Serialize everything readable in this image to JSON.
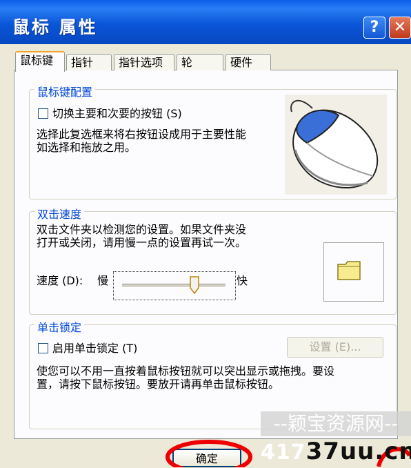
{
  "window": {
    "title": "鼠标 属性",
    "help_label": "?",
    "close_label": "✕"
  },
  "tabs": [
    {
      "label": "鼠标键"
    },
    {
      "label": "指针"
    },
    {
      "label": "指针选项"
    },
    {
      "label": "轮"
    },
    {
      "label": "硬件"
    }
  ],
  "button_config": {
    "legend": "鼠标键配置",
    "checkbox_label": "切换主要和次要的按钮 (S)",
    "description_line1": "选择此复选框来将右按钮设成用于主要性能",
    "description_line2": "如选择和拖放之用。"
  },
  "double_click": {
    "legend": "双击速度",
    "description_line1": "双击文件夹以检测您的设置。如果文件夹没",
    "description_line2": "打开或关闭，请用慢一点的设置再试一次。",
    "speed_label": "速度 (D):",
    "slow_label": "慢",
    "fast_label": "快",
    "slider_value": 0.7
  },
  "click_lock": {
    "legend": "单击锁定",
    "checkbox_label": "启用单击锁定 (T)",
    "settings_button": "设置 (E)...",
    "description_line1": "使您可以不用一直按着鼠标按钮就可以突出显示或拖拽。要设",
    "description_line2": "置，请按下鼠标按钮。要放开请再单击鼠标按钮。"
  },
  "footer": {
    "ok_button": "确定"
  },
  "watermark": {
    "line1": "--颖宝资源网--",
    "line2_prefix": "417",
    "line2_suffix": "37uu.cn"
  }
}
